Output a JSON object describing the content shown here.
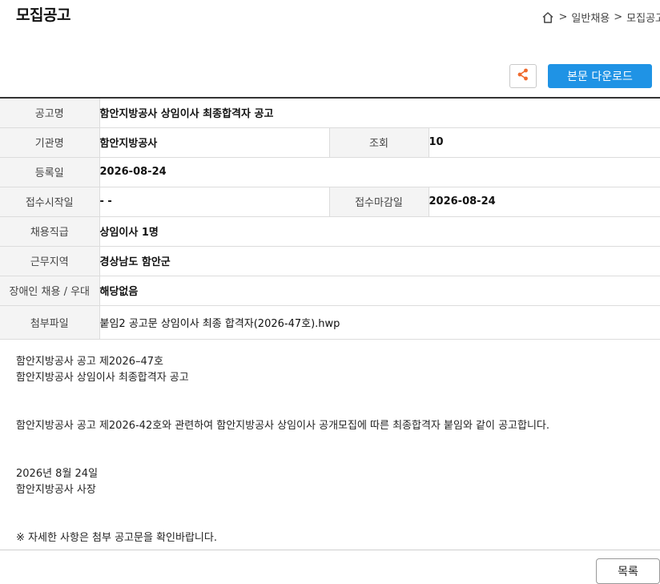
{
  "header": {
    "title": "모집공고",
    "breadcrumb": [
      {
        "icon": "home-icon",
        "sep": ">"
      },
      {
        "label": "일반채용",
        "sep": ">"
      },
      {
        "label": "모집공고"
      }
    ]
  },
  "toolbar": {
    "share_icon": "share-icon",
    "download_label": "본문 다운로드",
    "accent_color": "#1f93e5"
  },
  "info": {
    "title_label": "공고명",
    "title_value": "함안지방공사 상임이사 최종합격자 공고",
    "agency_label": "기관명",
    "agency_value": "함안지방공사",
    "views_label": "조회",
    "views_value": "10",
    "reg_label": "등록일",
    "reg_value": "2026-08-24",
    "start_label": "접수시작일",
    "start_value": "- -",
    "end_label": "접수마감일",
    "end_value": "2026-08-24",
    "position_label": "채용직급",
    "position_value": "상임이사 1명",
    "region_label": "근무지역",
    "region_value": "경상남도 함안군",
    "disability_label": "장애인 채용 / 우대",
    "disability_value": "해당없음",
    "attach_label": "첨부파일",
    "attach_value": "붙임2 공고문 상임이사 최종 합격자(2026-47호).hwp"
  },
  "body": {
    "line1": "함안지방공사 공고 제2026–47호",
    "line2": " 함안지방공사 상임이사 최종합격자 공고",
    "line3": " 함안지방공사 공고 제2026-42호와 관련하여 함안지방공사 상임이사 공개모집에 따른 최종합격자 붙임와 같이 공고합니다.",
    "date": "2026년 8월 24일",
    "signer": "함안지방공사 사장",
    "note": "※ 자세한 사항은 첨부 공고문을 확인바랍니다."
  },
  "footer": {
    "list_label": "목록"
  }
}
